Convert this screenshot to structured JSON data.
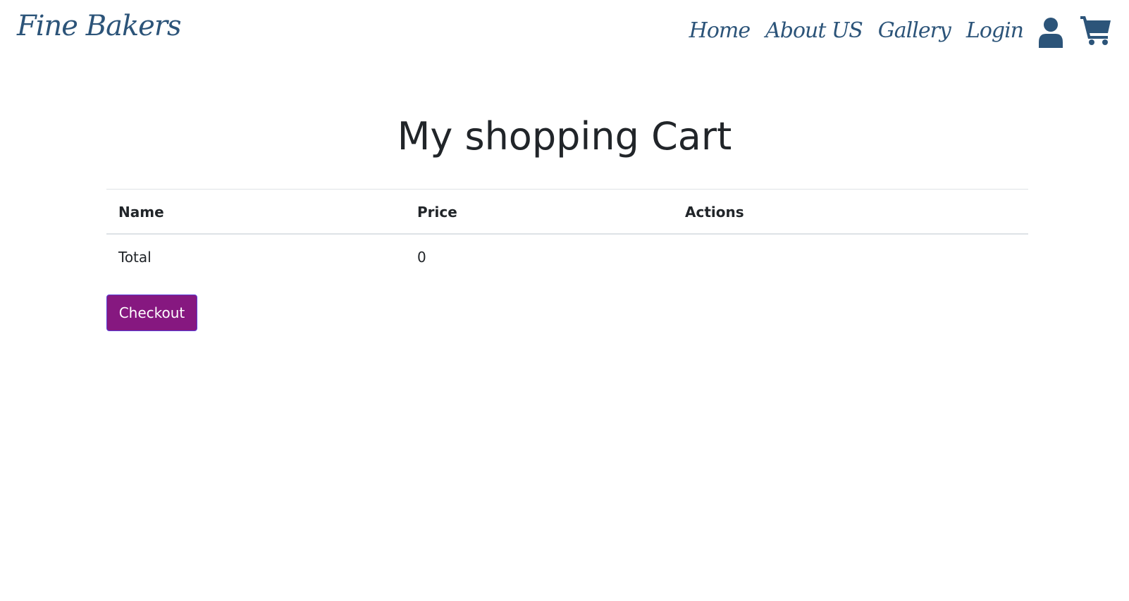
{
  "brand": {
    "name": "Fine Bakers",
    "color": "#2c5479"
  },
  "nav": {
    "items": [
      {
        "label": "Home"
      },
      {
        "label": "About US"
      },
      {
        "label": "Gallery"
      },
      {
        "label": "Login"
      }
    ],
    "user_icon": "user-icon",
    "cart_icon": "shopping-cart-icon"
  },
  "main": {
    "title": "My shopping Cart",
    "table": {
      "headers": [
        "Name",
        "Price",
        "Actions"
      ],
      "total_row": {
        "label": "Total",
        "value": "0",
        "actions": ""
      }
    },
    "checkout_label": "Checkout",
    "checkout_color": "#861880"
  }
}
